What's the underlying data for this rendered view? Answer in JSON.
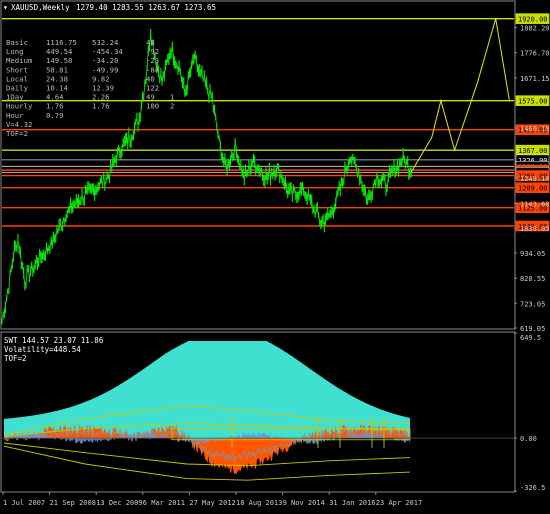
{
  "header": {
    "symbol": "XAUUSD,Weekly",
    "ohlc": "1279.40 1283.55 1263.67 1273.65"
  },
  "stats": {
    "rows": [
      {
        "label": "Basic",
        "a": "1116.75",
        "b": "532.24",
        "c": "48"
      },
      {
        "label": "Long",
        "a": "449.54",
        "b": "-454.34",
        "c": "-92"
      },
      {
        "label": "Medium",
        "a": "149.58",
        "b": "-34.20",
        "c": "-23"
      },
      {
        "label": "Short",
        "a": "58.81",
        "b": "-49.99",
        "c": "-84"
      },
      {
        "label": "Local",
        "a": "24.38",
        "b": "9.82",
        "c": "40"
      },
      {
        "label": "Daily",
        "a": "10.14",
        "b": "12.39",
        "c": "122"
      },
      {
        "label": "1Day",
        "a": "4.64",
        "b": "2.26",
        "c": "49",
        "d": "1"
      },
      {
        "label": "Hourly",
        "a": "1.76",
        "b": "1.76",
        "c": "100",
        "d": "2"
      },
      {
        "label": "Hour",
        "a": "0.79",
        "b": "",
        "c": ""
      }
    ],
    "v_line": "V=4.32",
    "tof_line": "TOF=2"
  },
  "indicator_header": {
    "name_line": "SWT 144.57 23.07 11.86",
    "volatility": "Volatility=448.54",
    "tof": "TOF=2"
  },
  "colors": {
    "price": "#00ee00",
    "level_yellow": "#c8e000",
    "level_red": "#ff4400",
    "level_white": "#dddddd",
    "projection": "#e8e800",
    "cyan": "#40e0d0",
    "orange": "#ff5500",
    "blue": "#7090d0",
    "grey": "#909090",
    "axis": "#cccccc"
  },
  "chart_data": [
    {
      "type": "line",
      "title": "XAUUSD,Weekly",
      "ylim": [
        619.05,
        1990
      ],
      "y_tick_labels": [
        {
          "value": 1882.2,
          "label": "1882.20"
        },
        {
          "value": 1776.7,
          "label": "1776.70"
        },
        {
          "value": 1671.15,
          "label": "1671.15"
        },
        {
          "value": 1460.1,
          "label": "1460.10"
        },
        {
          "value": 1249.1,
          "label": "1249.10"
        },
        {
          "value": 1143.6,
          "label": "1143.60"
        },
        {
          "value": 1039.05,
          "label": "1039.05"
        },
        {
          "value": 934.05,
          "label": "934.05"
        },
        {
          "value": 828.55,
          "label": "828.55"
        },
        {
          "value": 723.05,
          "label": "723.05"
        },
        {
          "value": 619.05,
          "label": "619.05"
        }
      ],
      "levels": [
        {
          "value": 1920.0,
          "label": "1920.00",
          "color": "yellow"
        },
        {
          "value": 1575.0,
          "label": "1575.00",
          "color": "yellow"
        },
        {
          "value": 1453.0,
          "label": "1453.00",
          "color": "red"
        },
        {
          "value": 1367.0,
          "label": "1367.00",
          "color": "yellow"
        },
        {
          "value": 1326.0,
          "label": "1326.00",
          "color": "white"
        },
        {
          "value": 1299.0,
          "label": "1299.00",
          "color": "white"
        },
        {
          "value": 1283.0,
          "label": "1283.00",
          "color": "red"
        },
        {
          "value": 1273.65,
          "label": "1273.65",
          "color": "white"
        },
        {
          "value": 1260.0,
          "label": "1260.00",
          "color": "red"
        },
        {
          "value": 1209.0,
          "label": "1209.00",
          "color": "red"
        },
        {
          "value": 1125.0,
          "label": "1125.00",
          "color": "red"
        },
        {
          "value": 1048.0,
          "label": "1048.00",
          "color": "red"
        }
      ],
      "x_labels": [
        "1 Jul 2007",
        "21 Sep 2008",
        "13 Dec 2009",
        "6 Mar 2011",
        "27 May 2012",
        "18 Aug 2013",
        "9 Nov 2014",
        "31 Jan 2016",
        "23 Apr 2017"
      ],
      "series": [
        {
          "values": [
            {
              "x": 0,
              "y": 650
            },
            {
              "x": 0.15,
              "y": 800
            },
            {
              "x": 0.25,
              "y": 930
            },
            {
              "x": 0.35,
              "y": 990
            },
            {
              "x": 0.5,
              "y": 820
            },
            {
              "x": 0.7,
              "y": 880
            },
            {
              "x": 0.9,
              "y": 930
            },
            {
              "x": 1.1,
              "y": 980
            },
            {
              "x": 1.4,
              "y": 1100
            },
            {
              "x": 1.7,
              "y": 1160
            },
            {
              "x": 2.0,
              "y": 1200
            },
            {
              "x": 2.3,
              "y": 1250
            },
            {
              "x": 2.6,
              "y": 1380
            },
            {
              "x": 2.8,
              "y": 1420
            },
            {
              "x": 3.0,
              "y": 1500
            },
            {
              "x": 3.15,
              "y": 1680
            },
            {
              "x": 3.25,
              "y": 1870
            },
            {
              "x": 3.35,
              "y": 1760
            },
            {
              "x": 3.5,
              "y": 1650
            },
            {
              "x": 3.7,
              "y": 1800
            },
            {
              "x": 3.9,
              "y": 1700
            },
            {
              "x": 4.0,
              "y": 1600
            },
            {
              "x": 4.2,
              "y": 1750
            },
            {
              "x": 4.4,
              "y": 1660
            },
            {
              "x": 4.6,
              "y": 1580
            },
            {
              "x": 4.75,
              "y": 1400
            },
            {
              "x": 4.9,
              "y": 1290
            },
            {
              "x": 5.1,
              "y": 1380
            },
            {
              "x": 5.3,
              "y": 1250
            },
            {
              "x": 5.5,
              "y": 1320
            },
            {
              "x": 5.8,
              "y": 1250
            },
            {
              "x": 6.0,
              "y": 1300
            },
            {
              "x": 6.3,
              "y": 1180
            },
            {
              "x": 6.6,
              "y": 1200
            },
            {
              "x": 6.8,
              "y": 1130
            },
            {
              "x": 7.0,
              "y": 1060
            },
            {
              "x": 7.2,
              "y": 1100
            },
            {
              "x": 7.4,
              "y": 1200
            },
            {
              "x": 7.6,
              "y": 1340
            },
            {
              "x": 7.8,
              "y": 1280
            },
            {
              "x": 8.0,
              "y": 1150
            },
            {
              "x": 8.2,
              "y": 1260
            },
            {
              "x": 8.4,
              "y": 1220
            },
            {
              "x": 8.6,
              "y": 1290
            },
            {
              "x": 8.8,
              "y": 1330
            },
            {
              "x": 8.95,
              "y": 1273.65
            }
          ]
        }
      ],
      "projection": [
        {
          "x": 8.95,
          "y": 1273.65
        },
        {
          "x": 9.4,
          "y": 1420
        },
        {
          "x": 9.6,
          "y": 1575
        },
        {
          "x": 9.9,
          "y": 1367
        },
        {
          "x": 10.4,
          "y": 1650
        },
        {
          "x": 10.8,
          "y": 1920
        },
        {
          "x": 11.1,
          "y": 1575
        }
      ]
    },
    {
      "type": "area",
      "title": "SWT 144.57 23.07 11.86",
      "ylim": [
        -326.5,
        649.5
      ],
      "y_tick_labels": [
        {
          "value": 649.5,
          "label": "649.5"
        },
        {
          "value": 0.0,
          "label": "0.00"
        },
        {
          "value": -326.5,
          "label": "-326.5"
        }
      ]
    }
  ]
}
